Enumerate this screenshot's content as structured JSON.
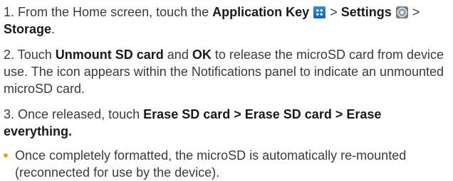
{
  "steps": [
    {
      "number": "1.",
      "parts": {
        "a": "From the Home screen, touch the",
        "app_key": "Application Key",
        "sep1": ">",
        "settings": "Settings",
        "sep2": ">",
        "storage": "Storage",
        "end": "."
      }
    },
    {
      "number": "2.",
      "parts": {
        "a": "Touch",
        "unmount": "Unmount SD card",
        "and": "and",
        "ok": "OK",
        "b": "to release the microSD card from device use. The icon appears within the Notifications panel to indicate an unmounted microSD card."
      }
    },
    {
      "number": "3.",
      "parts": {
        "a": "Once released, touch",
        "path": "Erase SD card > Erase SD card > Erase everything."
      }
    }
  ],
  "bullet": {
    "text": "Once completely formatted, the microSD is automatically re-mounted (reconnected for use by the device)."
  },
  "icons": {
    "app_key": "apps-grid-icon",
    "settings": "settings-gear-icon"
  },
  "colors": {
    "text": "#3a3a3a",
    "emphasis": "#1a1a1a",
    "bullet": "#e8a31c",
    "app_key_icon": "#1f7bc4"
  }
}
